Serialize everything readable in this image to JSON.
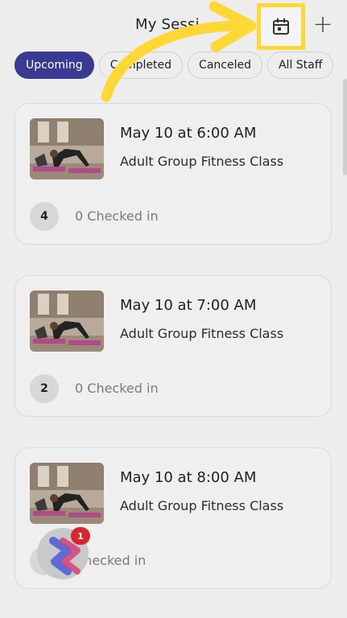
{
  "header": {
    "title": "My Sessi",
    "calendar_icon": "calendar-icon",
    "add_icon": "plus-icon",
    "add_label": "+"
  },
  "tabs": [
    {
      "label": "Upcoming",
      "active": true
    },
    {
      "label": "Completed",
      "active": false
    },
    {
      "label": "Canceled",
      "active": false
    },
    {
      "label": "All Staff",
      "active": false
    }
  ],
  "sessions": [
    {
      "time": "May 10 at 6:00 AM",
      "class_name": "Adult Group Fitness Class",
      "count": "4",
      "checked_in": "0 Checked in"
    },
    {
      "time": "May 10 at 7:00 AM",
      "class_name": "Adult Group Fitness Class",
      "count": "2",
      "checked_in": "0 Checked in"
    },
    {
      "time": "May 10 at 8:00 AM",
      "class_name": "Adult Group Fitness Class",
      "count": "",
      "checked_in": "Checked in"
    }
  ],
  "fab": {
    "badge": "1",
    "icon": "assistant-icon"
  },
  "colors": {
    "accent": "#3a3a95",
    "highlight": "#ffd836",
    "badge": "#d8262e"
  }
}
